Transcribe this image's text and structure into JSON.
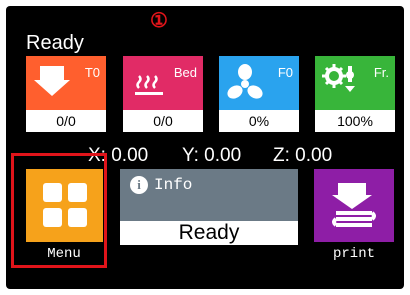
{
  "status": "Ready",
  "annotation_marker": "①",
  "tiles": [
    {
      "label": "T0",
      "value": "0/0",
      "icon": "extruder-down-arrow-icon",
      "color": "#ff5f2e"
    },
    {
      "label": "Bed",
      "value": "0/0",
      "icon": "heated-bed-icon",
      "color": "#e12b66"
    },
    {
      "label": "F0",
      "value": "0%",
      "icon": "fan-icon",
      "color": "#2aa3ee"
    },
    {
      "label": "Fr.",
      "value": "100%",
      "icon": "feedrate-gear-icon",
      "color": "#38b53a"
    }
  ],
  "coordinates": {
    "x": "X: 0.00",
    "y": "Y: 0.00",
    "z": "Z: 0.00"
  },
  "menu": {
    "label": "Menu",
    "icon": "grid-four-squares-icon",
    "color": "#f6a21b"
  },
  "info": {
    "title": "Info",
    "value": "Ready",
    "icon": "info-icon",
    "color": "#6b7a86"
  },
  "print": {
    "label": "print",
    "icon": "print-nozzle-icon",
    "color": "#8e1ea6"
  },
  "highlight_color": "#e0141a"
}
